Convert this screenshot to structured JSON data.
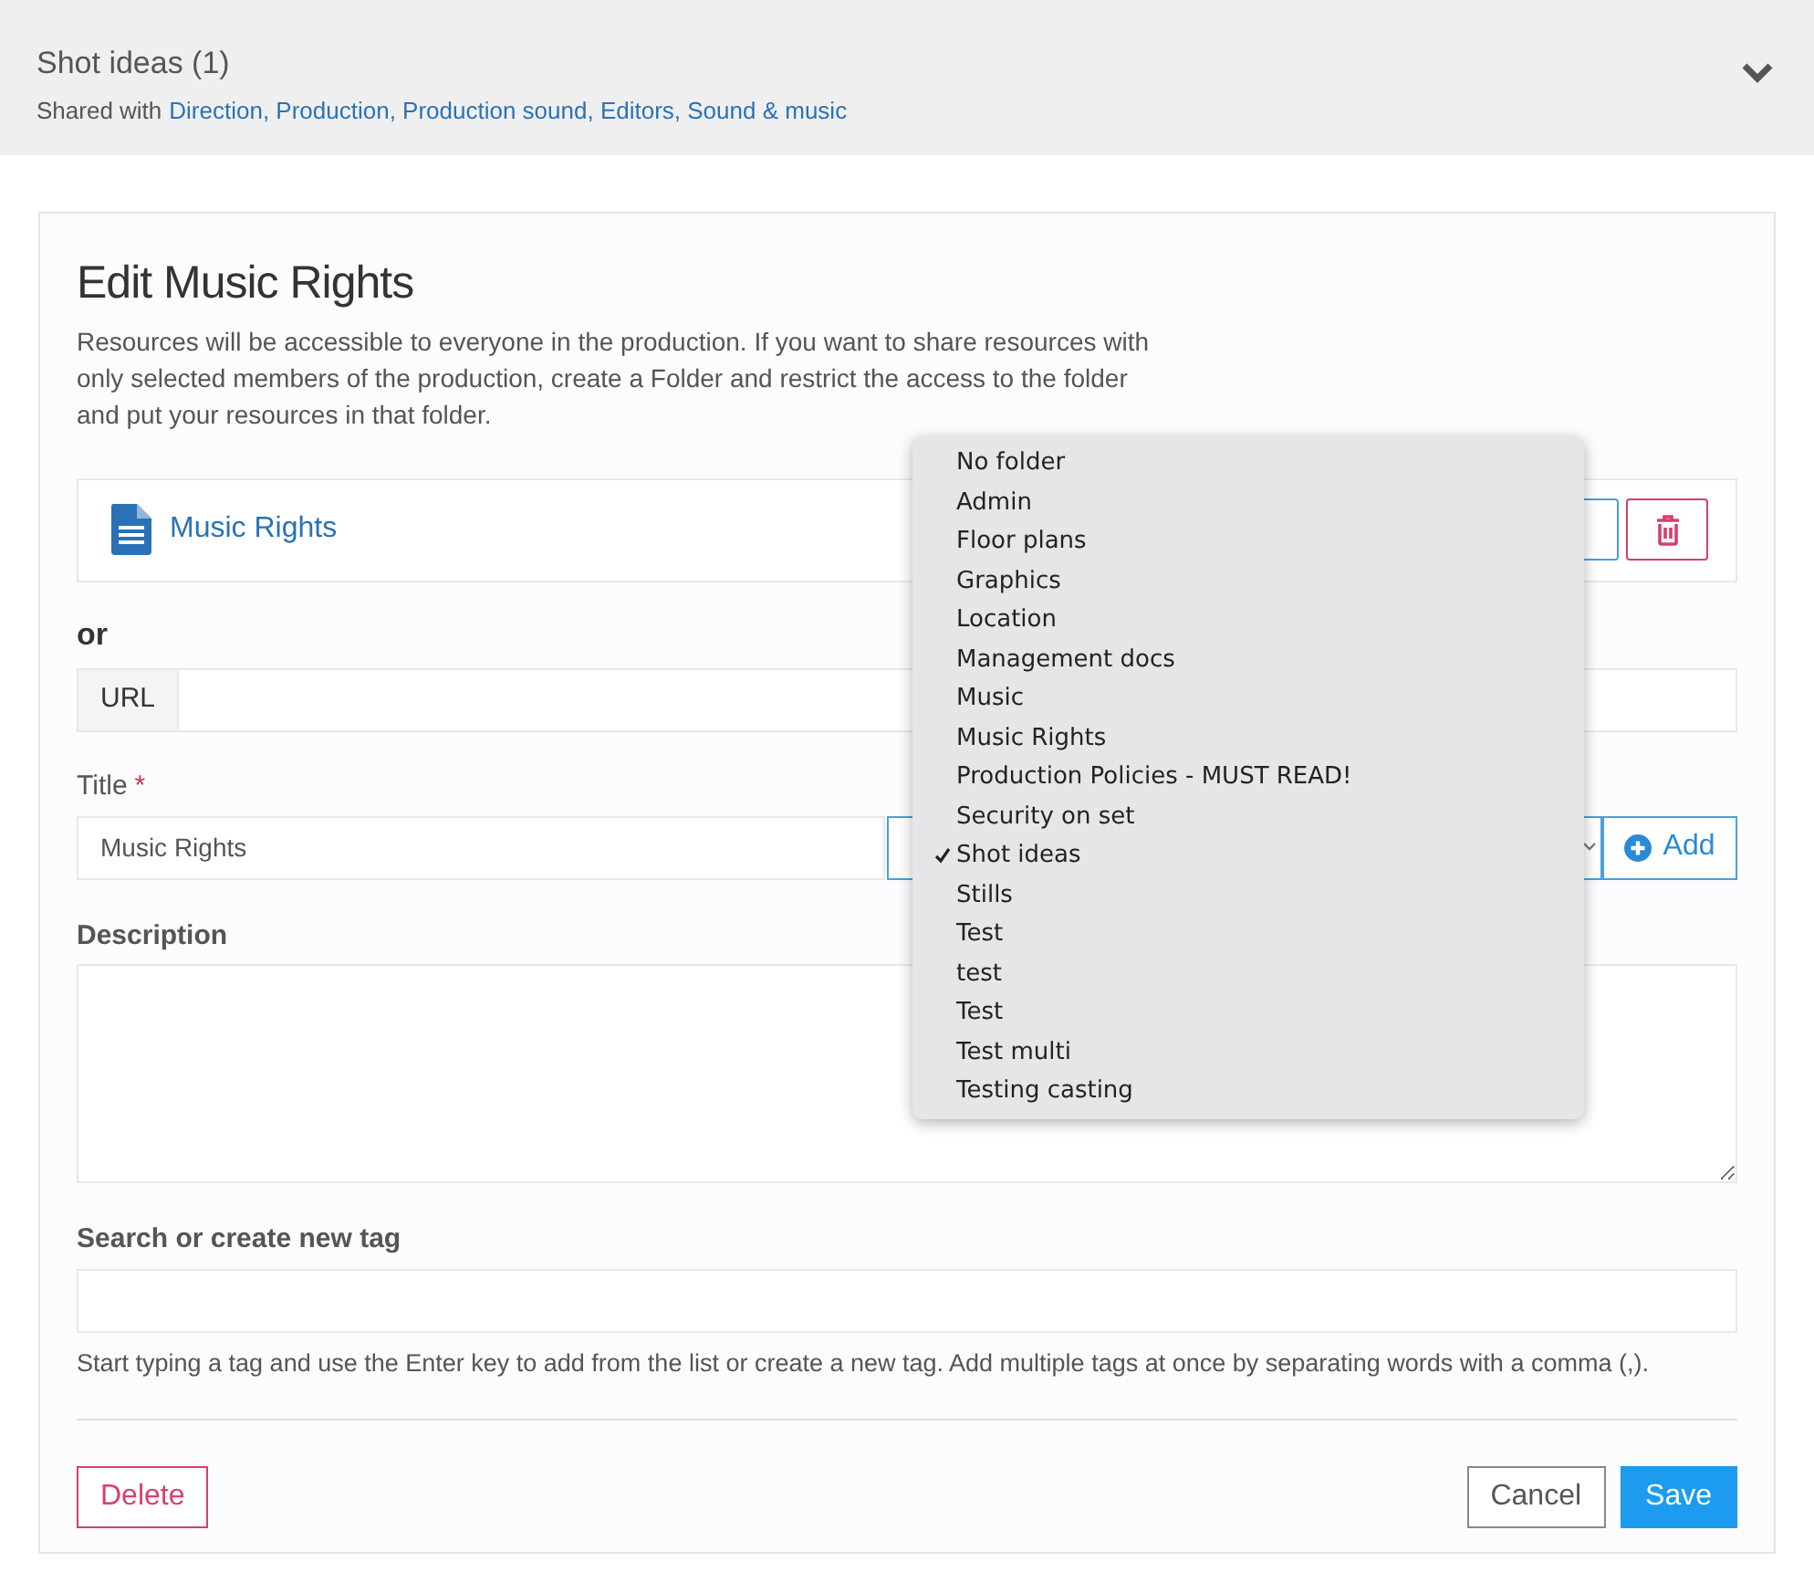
{
  "header": {
    "title": "Shot ideas (1)",
    "shared_label": "Shared with",
    "shared_with": "Direction, Production, Production sound, Editors, Sound & music"
  },
  "form": {
    "heading": "Edit Music Rights",
    "intro": "Resources will be accessible to everyone in the production. If you want to share resources with only selected members of the production, create a Folder and restrict the access to the folder and put your resources in that folder.",
    "file_name": "Music Rights",
    "or_label": "or",
    "url_addon": "URL",
    "title_label": "Title",
    "required_mark": "*",
    "title_value": "Music Rights",
    "add_button": "Add",
    "description_label": "Description",
    "tag_label": "Search or create new tag",
    "tag_help": "Start typing a tag and use the Enter key to add from the list or create a new tag. Add multiple tags at once by separating words with a comma (,).",
    "delete_button": "Delete",
    "cancel_button": "Cancel",
    "save_button": "Save"
  },
  "folder_menu": {
    "items": [
      {
        "label": "No folder",
        "selected": false
      },
      {
        "label": "Admin",
        "selected": false
      },
      {
        "label": "Floor plans",
        "selected": false
      },
      {
        "label": "Graphics",
        "selected": false
      },
      {
        "label": "Location",
        "selected": false
      },
      {
        "label": "Management docs",
        "selected": false
      },
      {
        "label": "Music",
        "selected": false
      },
      {
        "label": "Music Rights",
        "selected": false
      },
      {
        "label": "Production Policies - MUST READ!",
        "selected": false
      },
      {
        "label": "Security on set",
        "selected": false
      },
      {
        "label": "Shot ideas",
        "selected": true
      },
      {
        "label": "Stills",
        "selected": false
      },
      {
        "label": "Test",
        "selected": false
      },
      {
        "label": "test",
        "selected": false
      },
      {
        "label": "Test",
        "selected": false
      },
      {
        "label": "Test multi",
        "selected": false
      },
      {
        "label": "Testing casting",
        "selected": false
      }
    ]
  }
}
